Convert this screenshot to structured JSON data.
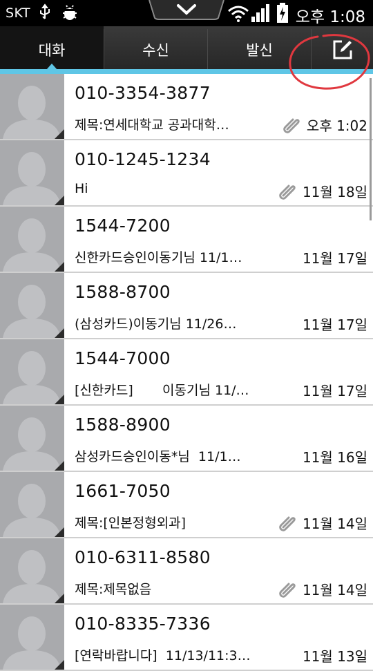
{
  "status_bar": {
    "carrier": "SKT",
    "time": "오후 1:08",
    "icons": [
      "usb-icon",
      "debug-icon",
      "wifi-icon",
      "signal-icon",
      "battery-charging-icon"
    ]
  },
  "tabs": [
    {
      "label": "대화",
      "active": true
    },
    {
      "label": "수신",
      "active": false
    },
    {
      "label": "발신",
      "active": false
    }
  ],
  "compose_icon": "compose-icon",
  "accent_color": "#5fc6e6",
  "annotation_color": "#e0383f",
  "conversations": [
    {
      "number": "010-3354-3877",
      "preview": "제목:연세대학교 공과대학…",
      "date": "오후 1:02",
      "attachment": true
    },
    {
      "number": "010-1245-1234",
      "preview": "Hi",
      "date": "11월 18일",
      "attachment": true
    },
    {
      "number": "1544-7200",
      "preview": "신한카드승인이동기님 11/1…",
      "date": "11월 17일",
      "attachment": false
    },
    {
      "number": "1588-8700",
      "preview": "(삼성카드)이동기님 11/26…",
      "date": "11월 17일",
      "attachment": false
    },
    {
      "number": "1544-7000",
      "preview": "[신한카드]       이동기님 11/…",
      "date": "11월 17일",
      "attachment": false
    },
    {
      "number": "1588-8900",
      "preview": "삼성카드승인이동*님  11/1…",
      "date": "11월 16일",
      "attachment": false
    },
    {
      "number": "1661-7050",
      "preview": "제목:[인본정형외과]",
      "date": "11월 14일",
      "attachment": true
    },
    {
      "number": "010-6311-8580",
      "preview": "제목:제목없음",
      "date": "11월 14일",
      "attachment": true
    },
    {
      "number": "010-8335-7336",
      "preview": "[연락바랍니다]  11/13/11:3…",
      "date": "11월 13일",
      "attachment": false
    }
  ]
}
